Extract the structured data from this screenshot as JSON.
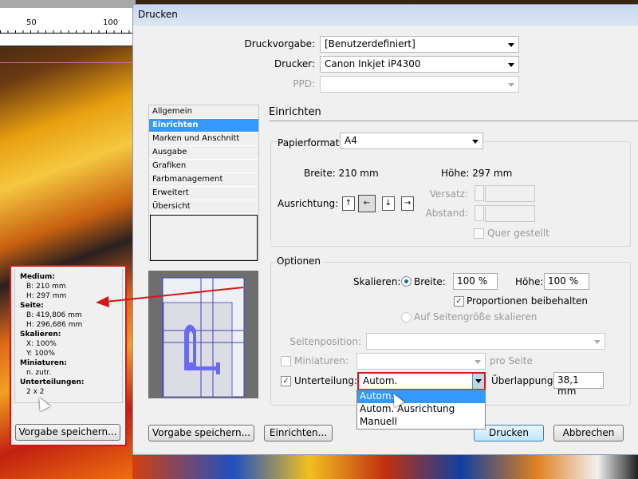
{
  "ruler": {
    "marks": [
      "50",
      "100"
    ]
  },
  "dialog": {
    "title": "Drucken",
    "druckvorgabe": {
      "label": "Druckvorgabe:",
      "value": "[Benutzerdefiniert]"
    },
    "drucker": {
      "label": "Drucker:",
      "value": "Canon Inkjet iP4300"
    },
    "ppd": {
      "label": "PPD:",
      "value": ""
    },
    "nav": [
      "Allgemein",
      "Einrichten",
      "Marken und Anschnitt",
      "Ausgabe",
      "Grafiken",
      "Farbmanagement",
      "Erweitert",
      "Übersicht"
    ],
    "section_title": "Einrichten",
    "setup": {
      "papierformat_label": "Papierformat:",
      "papierformat_value": "A4",
      "breite": "Breite: 210 mm",
      "hoehe": "Höhe: 297 mm",
      "ausrichtung_label": "Ausrichtung:",
      "versatz_label": "Versatz:",
      "abstand_label": "Abstand:",
      "quer_label": "Quer gestellt",
      "quer_checked": false
    },
    "optionen": {
      "title": "Optionen",
      "skalieren_label": "Skalieren:",
      "breite_label": "Breite:",
      "breite_value": "100 %",
      "hoehe_label": "Höhe:",
      "hoehe_value": "100 %",
      "proportionen_label": "Proportionen beibehalten",
      "proportionen_checked": true,
      "auf_seitengroesse_label": "Auf Seitengröße skalieren",
      "seitenposition_label": "Seitenposition:",
      "seitenposition_value": "",
      "miniaturen_label": "Miniaturen:",
      "miniaturen_value": "",
      "pro_seite": "pro Seite",
      "unterteilung_label": "Unterteilung:",
      "unterteilung_checked": true,
      "unterteilung_value": "Autom.",
      "ueberlappung_label": "Überlappung:",
      "ueberlappung_value": "38,1 mm",
      "dropdown_options": [
        "Autom.",
        "Autom. Ausrichtung",
        "Manuell"
      ],
      "dropdown_selected": "Autom."
    },
    "buttons": {
      "vorgabe": "Vorgabe speichern...",
      "einrichten": "Einrichten...",
      "drucken": "Drucken",
      "abbrechen": "Abbrechen"
    }
  },
  "info": {
    "medium_label": "Medium:",
    "medium_b": "B: 210 mm",
    "medium_h": "H: 297 mm",
    "seite_label": "Seite:",
    "seite_b": "B: 419,806 mm",
    "seite_h": "H: 296,686 mm",
    "skalieren_label": "Skalieren:",
    "skal_x": "X: 100%",
    "skal_y": "Y: 100%",
    "miniaturen_label": "Miniaturen:",
    "miniaturen_value": "n. zutr.",
    "unterteilungen_label": "Unterteilungen:",
    "unterteilungen_value": "2 x 2",
    "button": "Vorgabe speichern..."
  },
  "colors": {
    "highlight": "#3399ff",
    "annotation": "#d01818",
    "preview_lines": "#4040c0"
  }
}
